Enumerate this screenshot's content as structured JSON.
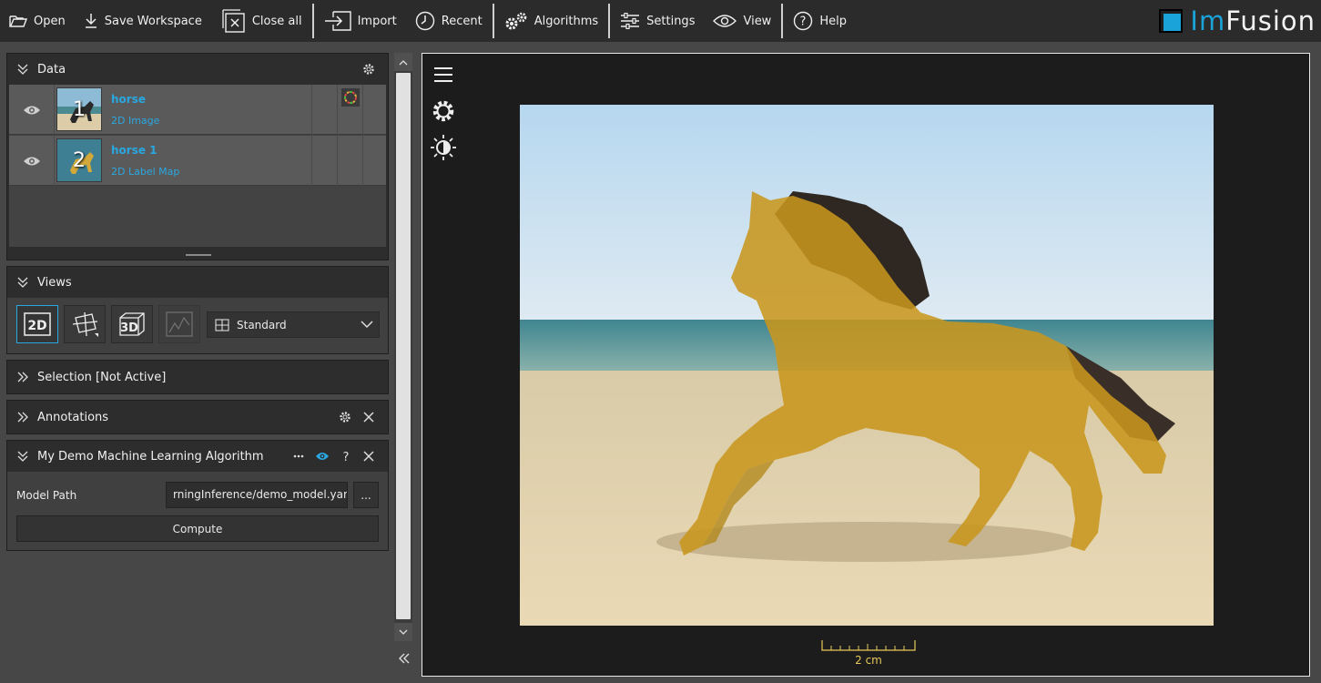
{
  "toolbar": {
    "open": "Open",
    "save_workspace": "Save Workspace",
    "close_all": "Close all",
    "import": "Import",
    "recent": "Recent",
    "algorithms": "Algorithms",
    "settings": "Settings",
    "view": "View",
    "help": "Help"
  },
  "logo": {
    "prefix": "Im",
    "suffix": "Fusion"
  },
  "data_panel": {
    "title": "Data",
    "items": [
      {
        "number": "1",
        "name": "horse",
        "kind": "2D Image"
      },
      {
        "number": "2",
        "name": "horse 1",
        "kind": "2D Label Map"
      }
    ]
  },
  "views_panel": {
    "title": "Views",
    "buttons": [
      "2D",
      "MPR",
      "3D",
      "Plot"
    ],
    "layout_value": "Standard"
  },
  "selection_panel": {
    "title": "Selection [Not Active]"
  },
  "annotations_panel": {
    "title": "Annotations"
  },
  "ml_panel": {
    "title": "My Demo Machine Learning Algorithm",
    "model_path_label": "Model Path",
    "model_path_value": "rningInference/demo_model.yaml",
    "browse_label": "...",
    "compute_label": "Compute"
  },
  "viewer": {
    "scale_label": "2 cm"
  },
  "colors": {
    "accent": "#2aa7e0",
    "label_overlay": "#c8961e",
    "scale_bar": "#e8c95a"
  }
}
